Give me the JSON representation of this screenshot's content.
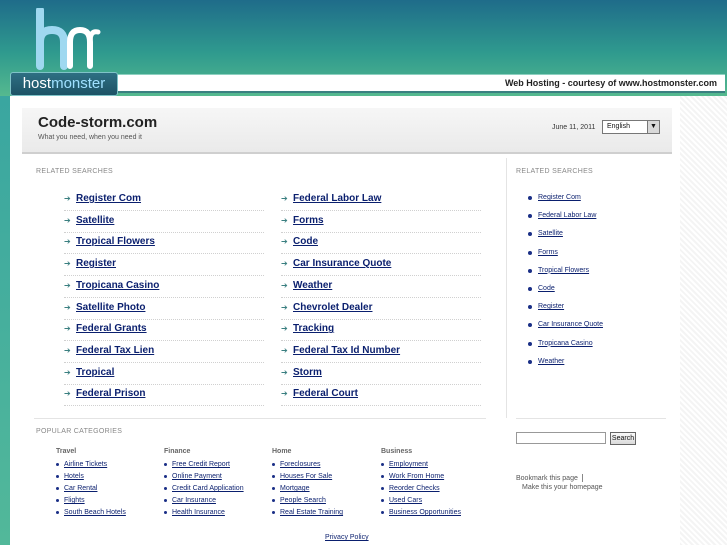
{
  "branding": {
    "logo_text_host": "host",
    "logo_text_monster": "monster",
    "hostbar_text": "Web Hosting - courtesy of www.hostmonster.com",
    "accent": "#3aa6a0"
  },
  "header": {
    "site_title": "Code-storm.com",
    "tagline": "What you need, when you need it",
    "date": "June 11, 2011",
    "language": "English"
  },
  "related": {
    "label": "RELATED SEARCHES",
    "left": [
      "Register Com",
      "Satellite",
      "Tropical Flowers",
      "Register",
      "Tropicana Casino",
      "Satellite Photo",
      "Federal Grants",
      "Federal Tax Lien",
      "Tropical",
      "Federal Prison"
    ],
    "right": [
      "Federal Labor Law",
      "Forms",
      "Code",
      "Car Insurance Quote",
      "Weather",
      "Chevrolet Dealer",
      "Tracking",
      "Federal Tax Id Number",
      "Storm",
      "Federal Court"
    ]
  },
  "side": {
    "label": "RELATED SEARCHES",
    "items": [
      "Register Com",
      "Federal Labor Law",
      "Satellite",
      "Forms",
      "Tropical Flowers",
      "Code",
      "Register",
      "Car Insurance Quote",
      "Tropicana Casino",
      "Weather"
    ],
    "search_button": "Search",
    "bookmark": "Bookmark this page",
    "homepage": "Make this your homepage"
  },
  "popular": {
    "label": "POPULAR CATEGORIES",
    "columns": [
      {
        "title": "Travel",
        "items": [
          "Airline Tickets",
          "Hotels",
          "Car Rental",
          "Flights",
          "South Beach Hotels"
        ]
      },
      {
        "title": "Finance",
        "items": [
          "Free Credit Report",
          "Online Payment",
          "Credit Card Application",
          "Car Insurance",
          "Health Insurance"
        ]
      },
      {
        "title": "Home",
        "items": [
          "Foreclosures",
          "Houses For Sale",
          "Mortgage",
          "People Search",
          "Real Estate Training"
        ]
      },
      {
        "title": "Business",
        "items": [
          "Employment",
          "Work From Home",
          "Reorder Checks",
          "Used Cars",
          "Business Opportunities"
        ]
      }
    ]
  },
  "footer": {
    "privacy": "Privacy Policy"
  }
}
